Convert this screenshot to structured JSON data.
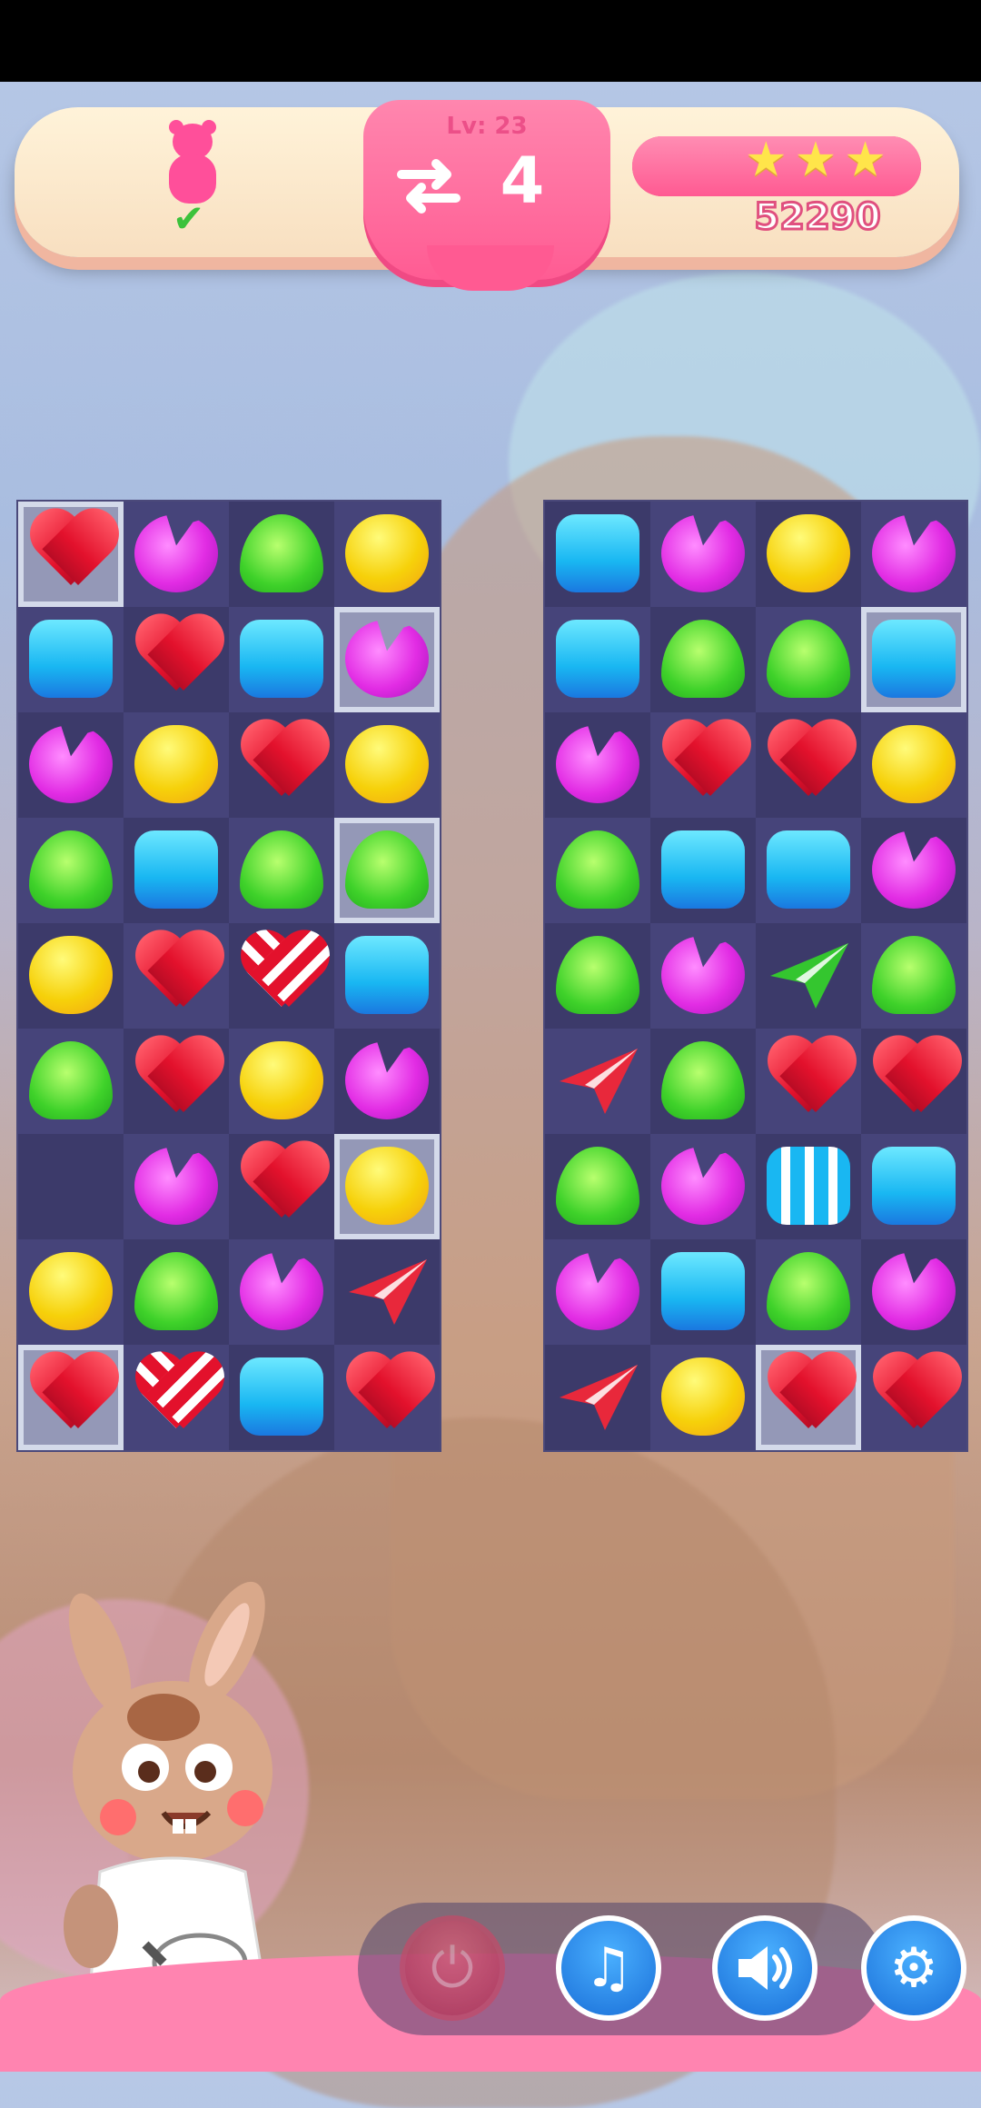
{
  "hud": {
    "level_text": "Lv: 23",
    "moves": "4",
    "score": "52290",
    "stars_earned": 3,
    "stars_text": "★★★",
    "progress_fraction": 1.0,
    "goal_icon": "gummy-bear-icon",
    "goal_status": "✔"
  },
  "icons": {
    "swap": "swap-arrows-icon",
    "power": "power-icon",
    "music": "music-note-icon",
    "sound": "speaker-icon",
    "settings": "gear-icon"
  },
  "menu": {
    "power_glyph": "⏻",
    "music_glyph": "♫",
    "sound_glyph": "🔊",
    "settings_glyph": "⚙"
  },
  "colors": {
    "accent_pink": "#ff5a92",
    "board_bg": "#3c3a6a",
    "menu_blue": "#1a6fd8"
  },
  "boards": {
    "left": [
      [
        "red:ice",
        "purple",
        "green",
        "yellow"
      ],
      [
        "blue",
        "red",
        "blue",
        "purple:ice"
      ],
      [
        "purple",
        "yellow",
        "red",
        "yellow"
      ],
      [
        "green",
        "blue",
        "green",
        "green:ice"
      ],
      [
        "yellow",
        "red",
        "red-striped",
        "blue"
      ],
      [
        "green",
        "red",
        "yellow",
        "purple"
      ],
      [
        "empty",
        "purple",
        "red",
        "yellow:ice"
      ],
      [
        "yellow",
        "green",
        "purple",
        "plane-red"
      ],
      [
        "red:ice",
        "red-striped-h",
        "blue",
        "red"
      ]
    ],
    "right": [
      [
        "blue",
        "purple",
        "yellow",
        "purple"
      ],
      [
        "blue",
        "green",
        "green",
        "blue:ice"
      ],
      [
        "purple",
        "red",
        "red",
        "yellow"
      ],
      [
        "green",
        "blue",
        "blue",
        "purple"
      ],
      [
        "green",
        "purple",
        "plane-green",
        "green"
      ],
      [
        "plane-red",
        "green",
        "red",
        "red"
      ],
      [
        "green",
        "purple",
        "blue-striped",
        "blue"
      ],
      [
        "purple",
        "blue",
        "green",
        "purple"
      ],
      [
        "plane-red",
        "yellow",
        "red:ice",
        "red"
      ]
    ]
  }
}
